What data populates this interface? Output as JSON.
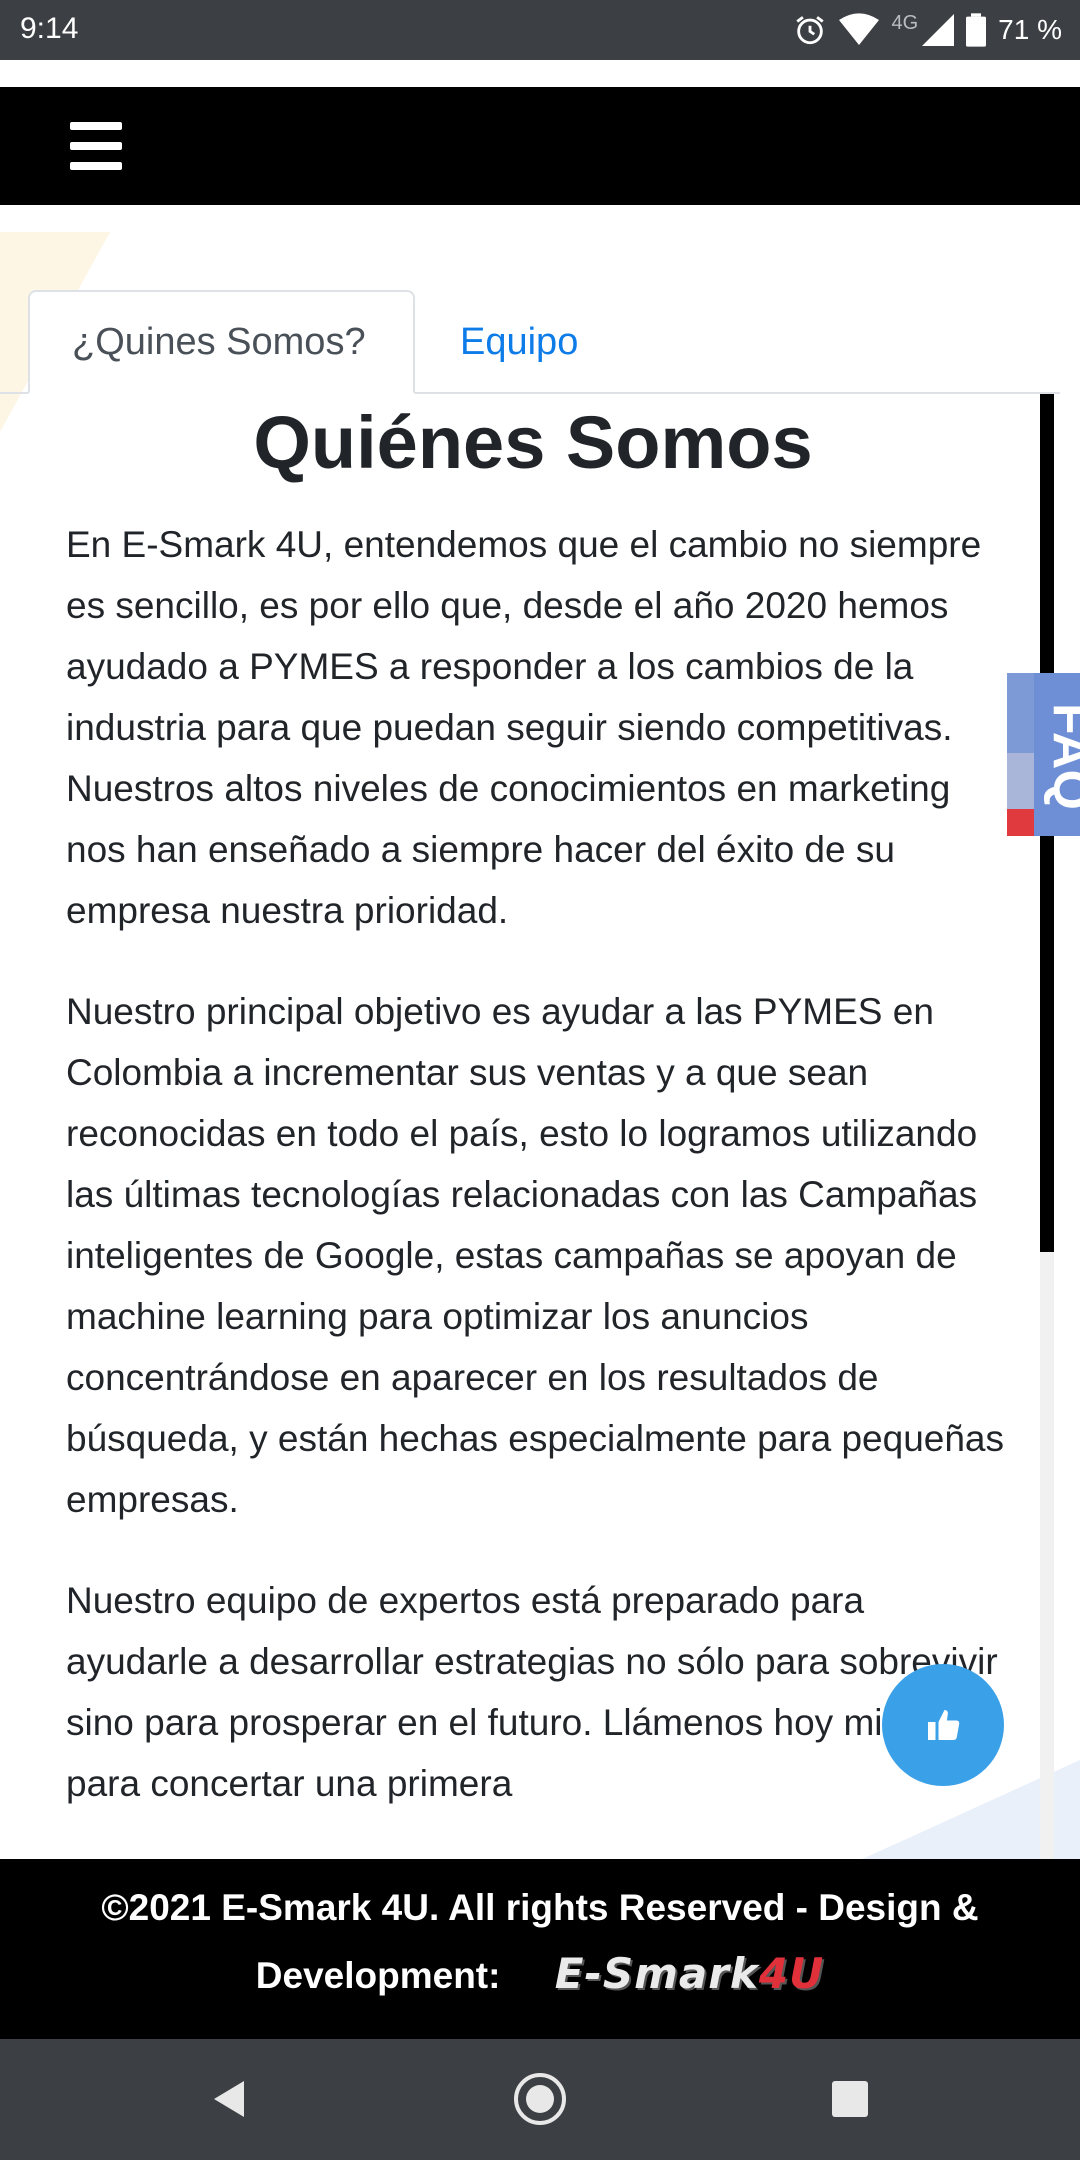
{
  "status_bar": {
    "time": "9:14",
    "network": "4G",
    "battery": "71 %"
  },
  "tabs": {
    "active_label": "¿Quines Somos?",
    "other_label": "Equipo"
  },
  "content": {
    "heading": "Quiénes Somos",
    "paragraphs": [
      "En E-Smark 4U, entendemos que el cambio no siempre es sencillo, es por ello que, desde el año 2020 hemos ayudado a PYMES a responder a los cambios de la industria para que puedan seguir siendo competitivas. Nuestros altos niveles de conocimientos en marketing nos han enseñado a siempre hacer del éxito de su empresa nuestra prioridad.",
      "Nuestro principal objetivo es ayudar a las PYMES en Colombia a incrementar sus ventas y a que sean reconocidas en todo el país, esto lo logramos utilizando las últimas tecnologías relacionadas con las Campañas inteligentes de Google, estas campañas se apoyan de machine learning para optimizar los anuncios concentrándose en aparecer en los resultados de búsqueda, y están hechas especialmente para pequeñas empresas.",
      "Nuestro equipo de expertos está preparado para ayudarle a desarrollar estrategias no sólo para sobrevivir sino para prosperar en el futuro. Llámenos hoy mismo para concertar una primera"
    ]
  },
  "faq": {
    "label": "FAQ"
  },
  "footer": {
    "line1": "©2021 E-Smark 4U. All rights Reserved - Design &",
    "line2": "Development:",
    "logo_text": "E-Smark",
    "logo_accent": "4U"
  },
  "colors": {
    "link": "#0d7ce8",
    "like_button": "#3aa0e8",
    "faq_blue": "#6e8fd6",
    "faq_red": "#e03a3e"
  },
  "icons": {
    "menu": "hamburger-menu-icon",
    "like": "thumbs-up-icon",
    "back": "back-triangle-icon",
    "home": "home-circle-icon",
    "recents": "recents-square-icon"
  }
}
